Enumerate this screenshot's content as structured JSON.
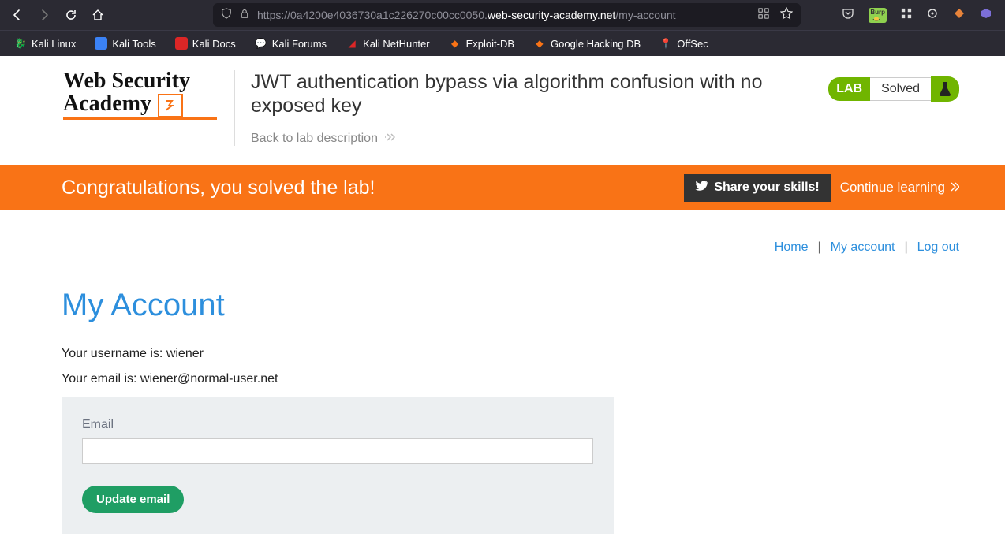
{
  "url": {
    "prefix": "https://0a4200e4036730a1c226270c00cc0050.",
    "host": "web-security-academy.net",
    "path": "/my-account"
  },
  "bookmarks": [
    {
      "label": "Kali Linux"
    },
    {
      "label": "Kali Tools"
    },
    {
      "label": "Kali Docs"
    },
    {
      "label": "Kali Forums"
    },
    {
      "label": "Kali NetHunter"
    },
    {
      "label": "Exploit-DB"
    },
    {
      "label": "Google Hacking DB"
    },
    {
      "label": "OffSec"
    }
  ],
  "logo": {
    "line1": "Web Security",
    "line2": "Academy"
  },
  "lab_title": "JWT authentication bypass via algorithm confusion with no exposed key",
  "back_link": "Back to lab description",
  "status": {
    "lab": "LAB",
    "solved": "Solved"
  },
  "banner": {
    "message": "Congratulations, you solved the lab!",
    "share": "Share your skills!",
    "continue": "Continue learning"
  },
  "nav": {
    "home": "Home",
    "account": "My account",
    "logout": "Log out"
  },
  "page": {
    "heading": "My Account",
    "username_line": "Your username is: wiener",
    "email_line": "Your email is: wiener@normal-user.net",
    "form": {
      "email_label": "Email",
      "button": "Update email"
    }
  }
}
